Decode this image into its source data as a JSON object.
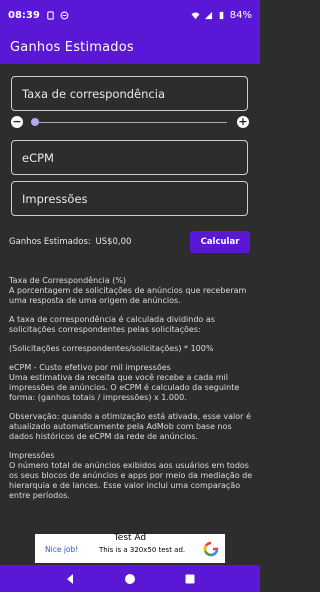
{
  "status": {
    "time": "08:39",
    "battery": "84%",
    "icons": [
      "sim-icon",
      "wifi-icon",
      "signal-icon",
      "battery-icon"
    ]
  },
  "appbar": {
    "title": "Ganhos Estimados"
  },
  "fields": {
    "match_rate": "Taxa de correspondência",
    "ecpm": "eCPM",
    "impressions": "Impressões"
  },
  "slider": {
    "minus": "−",
    "plus": "+",
    "value": 0.0
  },
  "earnings": {
    "label": "Ganhos Estimados:",
    "value": "US$0,00"
  },
  "calc_button": "Calcular",
  "info": {
    "p1": "Taxa de Correspondência (%)",
    "p2": "A porcentagem de solicitações de anúncios que receberam uma resposta de uma origem de anúncios.",
    "p3": "A taxa de correspondência é calculada dividindo as solicitações correspondentes pelas solicitações:",
    "p4": "(Solicitações correspondentes/solicitações) * 100%",
    "p5": "eCPM - Custo efetivo por mil impressões",
    "p6": "Uma estimativa da receita que você recebe a cada mil impressões de anúncios. O eCPM é calculado da seguinte forma: (ganhos totais / impressões) x 1.000.",
    "p7": "Observação: quando a otimização está ativada, esse valor é atualizado automaticamente pela AdMob com base nos dados históricos de eCPM da rede de anúncios.",
    "p8": "Impressões",
    "p9": "O número total de anúncios exibidos aos usuários em todos os seus blocos de anúncios e apps por meio da mediação de hierarquia e de lances. Esse valor inclui uma comparação entre períodos."
  },
  "ad": {
    "title": "Test Ad",
    "nice_job": "Nice job!",
    "text": "This is a 320x50 test ad."
  },
  "colors": {
    "accent": "#5a17d6",
    "background": "#2d2d2d"
  }
}
